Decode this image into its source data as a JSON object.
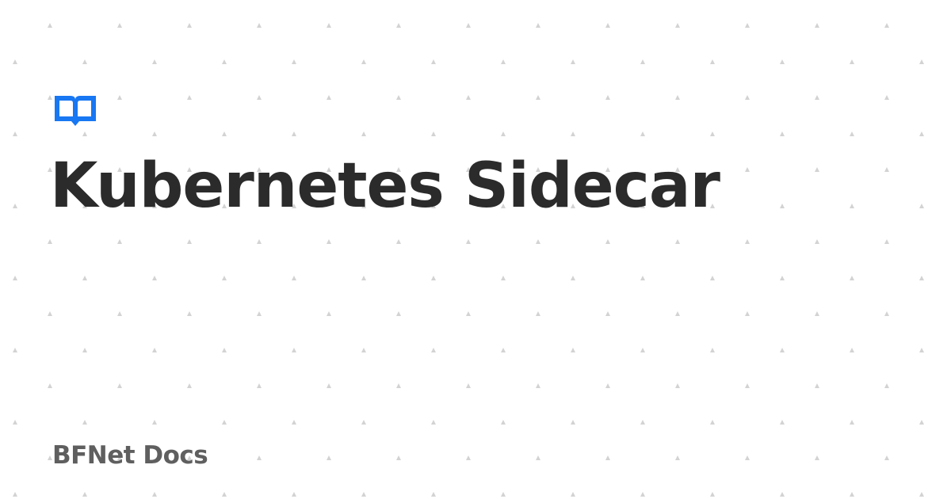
{
  "card": {
    "title": "Kubernetes Sidecar",
    "site_name": "BFNet Docs",
    "logo_icon": "book-icon"
  },
  "colors": {
    "background": "#ffffff",
    "title": "#2b2b2b",
    "site_name": "#5f5f5f",
    "accent": "#1877f2",
    "pattern": "#d3d3d3"
  }
}
